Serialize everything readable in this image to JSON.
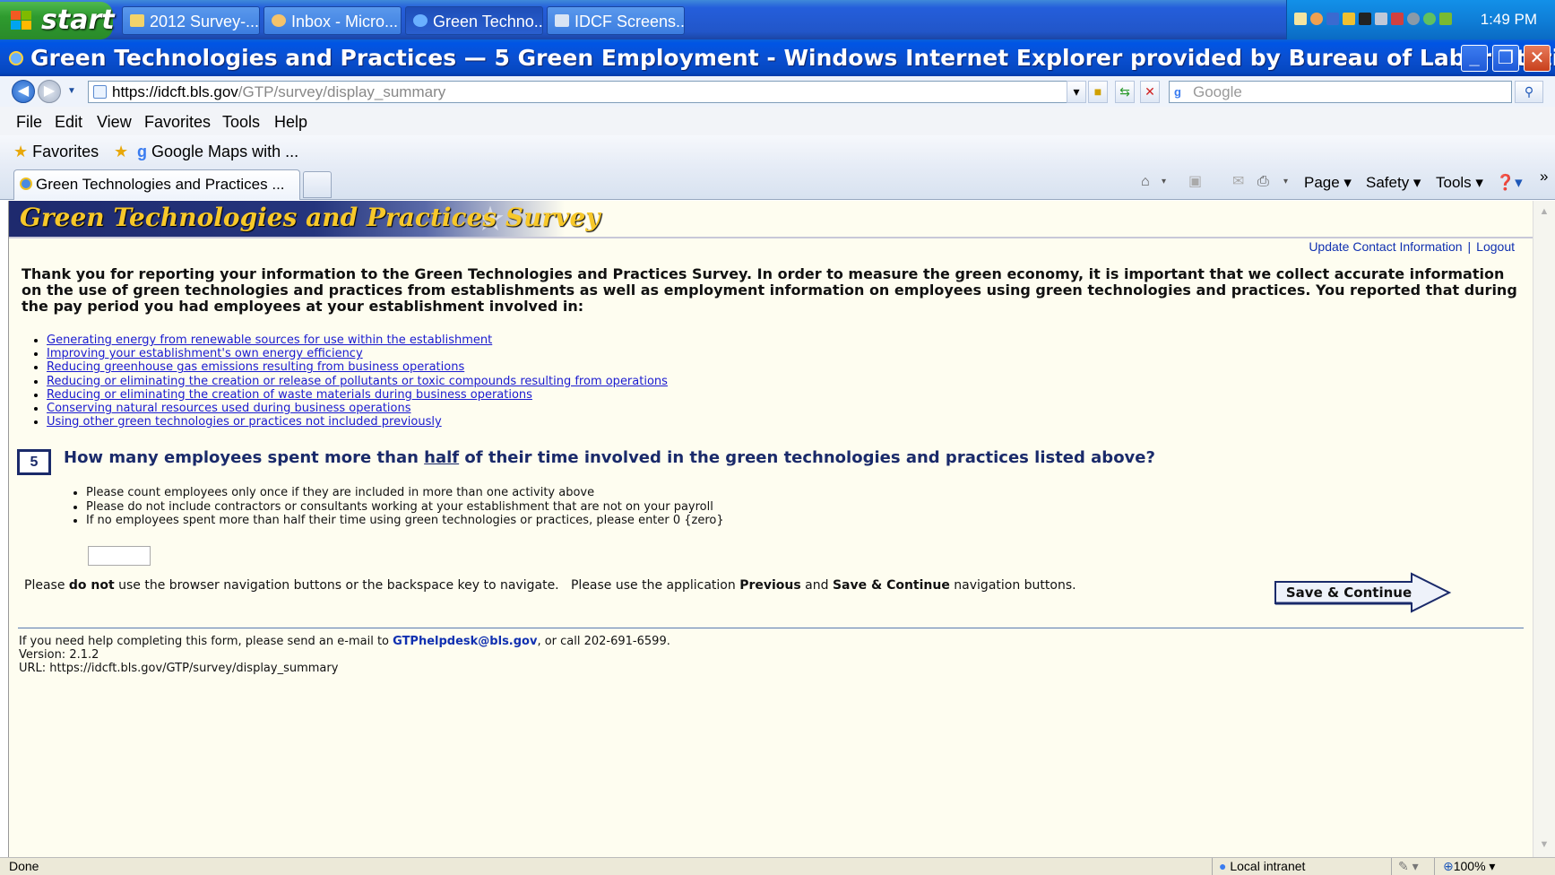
{
  "taskbar": {
    "start_label": "start",
    "tasks": [
      {
        "label": "2012 Survey-...",
        "icon": "folder-icon"
      },
      {
        "label": "Inbox - Micro...",
        "icon": "outlook-icon"
      },
      {
        "label": "Green Techno...",
        "icon": "ie-icon"
      },
      {
        "label": "IDCF Screens....",
        "icon": "document-icon"
      }
    ],
    "clock": "1:49 PM"
  },
  "window": {
    "title": "Green Technologies and Practices — 5 Green Employment - Windows Internet Explorer provided by Bureau of Labor Statistics",
    "minimize": "_",
    "maximize": "❐",
    "close": "✕"
  },
  "address": {
    "url_host": "https://idcft.bls.gov",
    "url_path": "/GTP/survey/display_summary",
    "search_placeholder": "Google"
  },
  "menu": {
    "items": [
      "File",
      "Edit",
      "View",
      "Favorites",
      "Tools",
      "Help"
    ]
  },
  "favorites": {
    "label": "Favorites",
    "items": [
      "Google Maps with ..."
    ]
  },
  "tabs": {
    "active_label": "Green Technologies and Practices ...",
    "commands": [
      "Page",
      "Safety",
      "Tools"
    ]
  },
  "page": {
    "banner_title": "Green Technologies and Practices Survey",
    "top_links": [
      "Update Contact Information",
      "Logout"
    ],
    "intro": "Thank you for reporting your information to the Green Technologies and Practices Survey. In order to measure the green economy, it is important that we collect accurate information on the use of green technologies and practices from establishments as well as employment information on employees using green technologies and practices. You reported that during the pay period you had employees at your establishment involved in:",
    "activities": [
      "Generating energy from renewable sources for use within the establishment",
      "Improving your establishment's own energy efficiency",
      "Reducing greenhouse gas emissions resulting from business operations",
      "Reducing or eliminating the creation or release of pollutants or toxic compounds resulting from operations",
      "Reducing or eliminating the creation of waste materials during business operations",
      "Conserving natural resources used during business operations",
      "Using other green technologies or practices not included previously"
    ],
    "question": {
      "number": "5",
      "text_before": "How many employees spent more than ",
      "text_emphasis": "half",
      "text_after": " of their time involved in the green technologies and practices listed above?"
    },
    "instructions": [
      "Please count employees only once if they are included in more than one activity above",
      "Please do not include contractors or consultants working at your establishment that are not on your payroll",
      "If no employees spent more than half their time using green technologies or practices, please enter 0 {zero}"
    ],
    "employee_count_value": "",
    "nav_note": {
      "p1": "Please ",
      "b1": "do not",
      "p2": " use the browser navigation buttons or the backspace key to navigate.   Please use the application ",
      "b2": "Previous",
      "p3": " and ",
      "b3": "Save & Continue",
      "p4": " navigation buttons."
    },
    "save_continue_label": "Save & Continue",
    "footer": {
      "help_before": "If you need help completing this form, please send an e-mail to ",
      "help_email": "GTPhelpdesk@bls.gov",
      "help_after": ", or call 202-691-6599.",
      "version": "Version: 2.1.2",
      "url": "URL: https://idcft.bls.gov/GTP/survey/display_summary"
    }
  },
  "statusbar": {
    "status": "Done",
    "zone": "Local intranet",
    "zoom": "100%"
  },
  "colors": {
    "banner_navy": "#1e2a6e",
    "banner_gold": "#f7c82a",
    "link_blue": "#1a1ad0",
    "question_navy": "#1a2a6a",
    "page_bg": "#fefdf0"
  }
}
